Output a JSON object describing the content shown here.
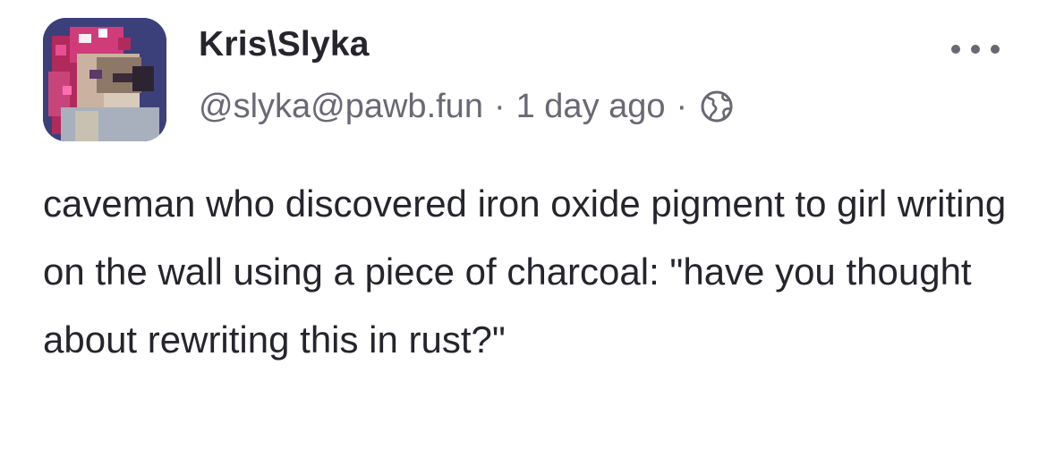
{
  "post": {
    "author": {
      "display_name": "Kris\\Slyka",
      "handle": "@slyka@pawb.fun",
      "avatar_icon": "avatar-pixel-art"
    },
    "timestamp": "1 day ago",
    "separator": "·",
    "visibility_icon": "globe-icon",
    "menu_icon": "more-icon",
    "content": "caveman who discovered iron oxide pigment to girl writing on the wall using a piece of charcoal: \"have you thought about rewriting this in rust?\""
  },
  "colors": {
    "text_primary": "#26242c",
    "text_secondary": "#6a6875",
    "avatar_background": "#3b3f7a"
  }
}
